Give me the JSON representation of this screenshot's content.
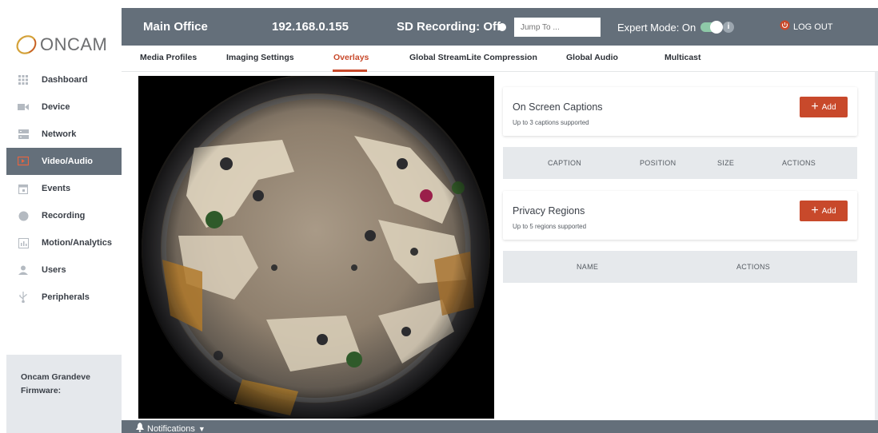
{
  "app": {
    "logo_text": "ONCAM"
  },
  "sidebar": {
    "items": [
      {
        "label": "Dashboard",
        "icon": "grid-icon"
      },
      {
        "label": "Device",
        "icon": "camera-icon"
      },
      {
        "label": "Network",
        "icon": "network-icon"
      },
      {
        "label": "Video/Audio",
        "icon": "video-icon",
        "active": true
      },
      {
        "label": "Events",
        "icon": "calendar-icon"
      },
      {
        "label": "Recording",
        "icon": "record-icon"
      },
      {
        "label": "Motion/Analytics",
        "icon": "chart-icon"
      },
      {
        "label": "Users",
        "icon": "user-icon"
      },
      {
        "label": "Peripherals",
        "icon": "usb-icon"
      }
    ],
    "firmware": {
      "line1": "Oncam Grandeve",
      "line2": "Firmware:"
    }
  },
  "header": {
    "device_name": "Main Office",
    "ip": "192.168.0.155",
    "sd_recording": "SD Recording: Off",
    "jump_placeholder": "Jump To ...",
    "expert_mode": "Expert Mode: On",
    "logout": "LOG OUT"
  },
  "tabs": [
    {
      "label": "Media Profiles"
    },
    {
      "label": "Imaging Settings"
    },
    {
      "label": "Overlays",
      "active": true
    },
    {
      "label": "Global StreamLite Compression"
    },
    {
      "label": "Global Audio"
    },
    {
      "label": "Multicast"
    }
  ],
  "captions": {
    "title": "On Screen Captions",
    "subtitle": "Up to 3 captions supported",
    "add_label": "Add",
    "columns": [
      "CAPTION",
      "POSITION",
      "SIZE",
      "ACTIONS"
    ]
  },
  "privacy": {
    "title": "Privacy Regions",
    "subtitle": "Up to 5 regions supported",
    "add_label": "Add",
    "columns": [
      "NAME",
      "ACTIONS"
    ]
  },
  "footer": {
    "notifications": "Notifications"
  },
  "colors": {
    "accent": "#c8492b",
    "bar": "#646f7a",
    "active_nav": "#646f7a",
    "toggle_on": "#8ec9a8"
  }
}
